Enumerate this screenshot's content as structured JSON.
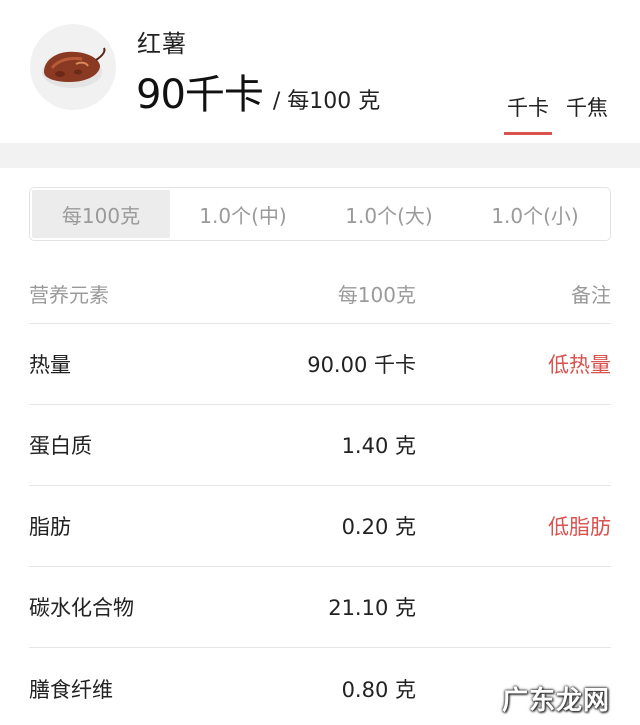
{
  "food": {
    "name": "红薯",
    "calories": "90千卡",
    "per_unit": "/ 每100 克"
  },
  "energy_units": [
    "千卡",
    "千焦"
  ],
  "energy_units_active": "千卡",
  "portions": [
    "每100克",
    "1.0个(中)",
    "1.0个(大)",
    "1.0个(小)"
  ],
  "portions_active": "每100克",
  "table": {
    "headers": [
      "营养元素",
      "每100克",
      "备注"
    ],
    "rows": [
      {
        "name": "热量",
        "value": "90.00 千卡",
        "note": "低热量"
      },
      {
        "name": "蛋白质",
        "value": "1.40 克",
        "note": ""
      },
      {
        "name": "脂肪",
        "value": "0.20 克",
        "note": "低脂肪"
      },
      {
        "name": "碳水化合物",
        "value": "21.10 克",
        "note": ""
      },
      {
        "name": "膳食纤维",
        "value": "0.80 克",
        "note": ""
      }
    ]
  },
  "watermark": "广东龙网",
  "colors": {
    "accent": "#d9534f",
    "muted": "#9a9a9a",
    "band": "#f2f2f2"
  }
}
